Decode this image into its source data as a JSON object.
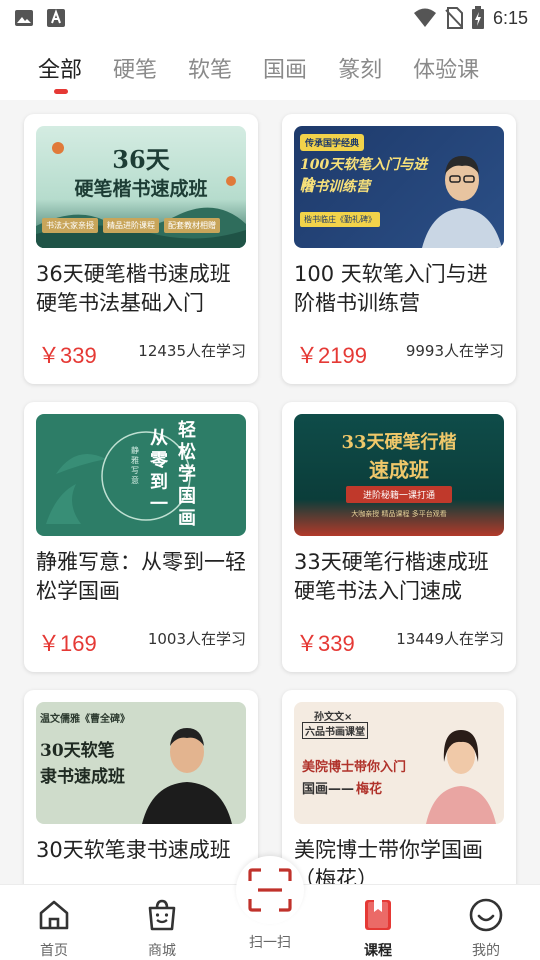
{
  "status_bar": {
    "time": "6:15"
  },
  "tabs": [
    {
      "label": "全部",
      "active": true
    },
    {
      "label": "硬笔",
      "active": false
    },
    {
      "label": "软笔",
      "active": false
    },
    {
      "label": "国画",
      "active": false
    },
    {
      "label": "篆刻",
      "active": false
    },
    {
      "label": "体验课",
      "active": false
    }
  ],
  "courses": [
    {
      "title": "36天硬笔楷书速成班 硬笔书法基础入门",
      "price": "￥339",
      "learners": "12435人在学习",
      "thumb": {
        "headline": "36天",
        "headline2": "硬笔楷书速成班",
        "tags": [
          "书法大家亲授",
          "精品进阶课程",
          "配套教材相赠"
        ]
      }
    },
    {
      "title": "100 天软笔入门与进阶楷书训练营",
      "price": "￥2199",
      "learners": "9993人在学习",
      "thumb": {
        "badge": "传承国学经典",
        "headline": "100天软笔入门与进阶",
        "headline2": "楷书训练营",
        "note": "楷书临庄《勤礼碑》"
      }
    },
    {
      "title": "静雅写意：从零到一轻松学国画",
      "price": "￥169",
      "learners": "1003人在学习",
      "thumb": {
        "col1": "从零到一",
        "col2": "轻松学国画",
        "seal": "静雅写意"
      }
    },
    {
      "title": "33天硬笔行楷速成班 硬笔书法入门速成",
      "price": "￥339",
      "learners": "13449人在学习",
      "thumb": {
        "headline": "33天硬笔行楷",
        "headline2": "速成班",
        "ribbon": "进阶秘籍一课打通",
        "footer": "大咖亲授  精品课程  多平台观看"
      }
    },
    {
      "title": "30天软笔隶书速成班",
      "price": "",
      "learners": "",
      "thumb": {
        "badge": "温文儒雅《曹全碑》",
        "headline": "30天软笔",
        "headline2": "隶书速成班"
      }
    },
    {
      "title": "美院博士带你学国画（梅花）",
      "price": "",
      "learners": "",
      "thumb": {
        "badge": "孙文文×",
        "badge2": "六品书画课堂",
        "headline": "美院博士带你入门",
        "headline2": "国画——",
        "headline3": "梅花"
      }
    }
  ],
  "bottom_nav": [
    {
      "label": "首页",
      "icon": "home-icon",
      "active": false
    },
    {
      "label": "商城",
      "icon": "shopping-bag-icon",
      "active": false
    },
    {
      "label": "扫一扫",
      "icon": "scan-icon",
      "active": false
    },
    {
      "label": "课程",
      "icon": "course-book-icon",
      "active": true
    },
    {
      "label": "我的",
      "icon": "profile-smile-icon",
      "active": false
    }
  ],
  "colors": {
    "accent": "#e53935",
    "text": "#222222",
    "muted": "#8a8a8a"
  }
}
